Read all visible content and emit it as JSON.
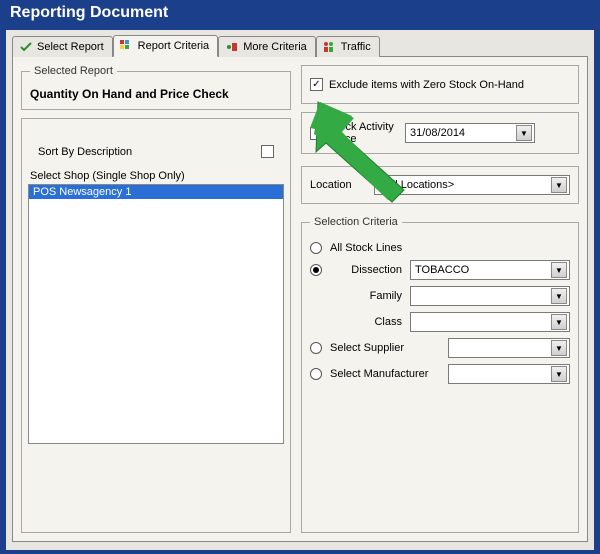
{
  "window": {
    "title": "Reporting Document"
  },
  "tabs": [
    {
      "label": "Select Report"
    },
    {
      "label": "Report Criteria"
    },
    {
      "label": "More Criteria"
    },
    {
      "label": "Traffic"
    }
  ],
  "left": {
    "selected_report_legend": "Selected Report",
    "report_name": "Quantity On Hand and Price Check",
    "sort_label": "Sort By Description",
    "shop_label": "Select Shop (Single Shop Only)",
    "shop_items": [
      "POS Newsagency 1"
    ]
  },
  "right": {
    "exclude_label": "Exclude items with Zero Stock On-Hand",
    "stock_activity_label": "Stock Activity Since",
    "stock_activity_date": "31/08/2014",
    "location_label": "Location",
    "location_value": "<All Locations>",
    "selection_legend": "Selection Criteria",
    "all_stock_label": "All Stock Lines",
    "dissection_label": "Dissection",
    "dissection_value": "TOBACCO",
    "family_label": "Family",
    "family_value": "",
    "class_label": "Class",
    "class_value": "",
    "select_supplier_label": "Select Supplier",
    "supplier_value": "",
    "select_manufacturer_label": "Select Manufacturer",
    "manufacturer_value": ""
  }
}
